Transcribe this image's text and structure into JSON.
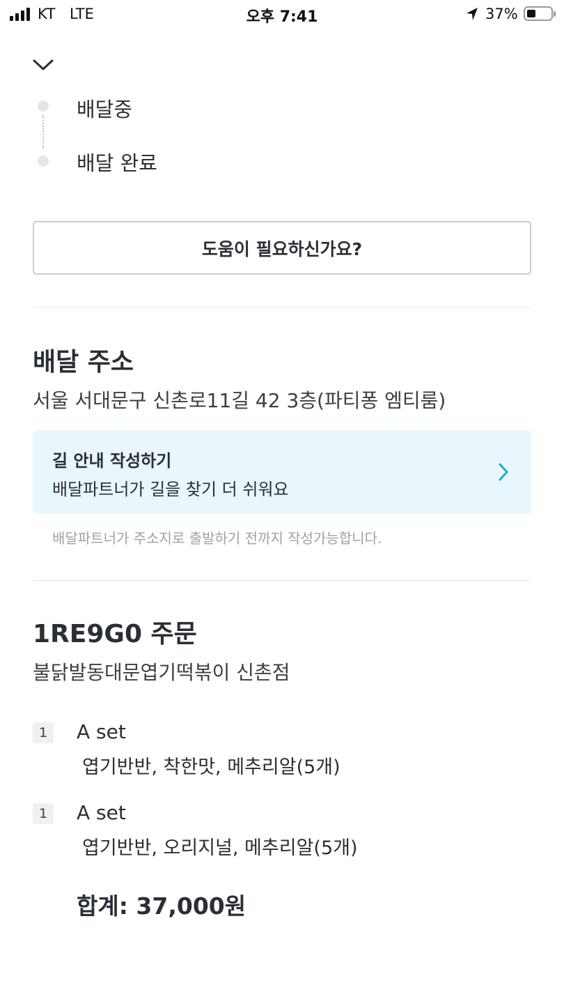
{
  "status_bar": {
    "carrier": "KT",
    "network": "LTE",
    "time": "오후 7:41",
    "battery_percent": "37%",
    "battery_level": 0.37,
    "icons": [
      "signal-icon",
      "location-arrow-icon",
      "battery-icon"
    ]
  },
  "header": {
    "collapse_icon": "chevron-down-icon"
  },
  "timeline": {
    "steps": [
      {
        "label": "배달중"
      },
      {
        "label": "배달 완료"
      }
    ]
  },
  "help": {
    "button_label": "도움이 필요하신가요?"
  },
  "delivery_address": {
    "title": "배달 주소",
    "address": "서울 서대문구 신촌로11길 42 3층(파티퐁 엠티룸)",
    "guide": {
      "title": "길 안내 작성하기",
      "subtitle": "배달파트너가 길을 찾기 더 쉬워요",
      "chevron_icon": "chevron-right-icon",
      "accent_color": "#1ea9d8",
      "background_color": "#e9f7fc"
    },
    "note": "배달파트너가 주소지로 출발하기 전까지 작성가능합니다."
  },
  "order": {
    "title": "1RE9G0 주문",
    "store": "불닭발동대문엽기떡볶이 신촌점",
    "items": [
      {
        "qty": "1",
        "name": "A set",
        "options": "엽기반반, 착한맛, 메추리알(5개)"
      },
      {
        "qty": "1",
        "name": "A set",
        "options": "엽기반반, 오리지널, 메추리알(5개)"
      }
    ],
    "total": "합계: 37,000원"
  }
}
